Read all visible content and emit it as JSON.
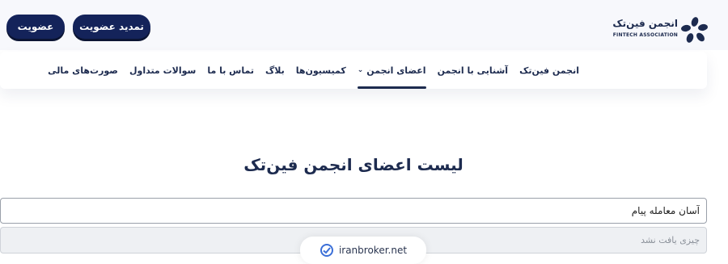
{
  "brand": {
    "title": "انجمن فین‌تک",
    "subtitle": "FINTECH ASSOCIATION",
    "logo_icon": "fintech-logo-mark",
    "color": "#1d2b4f"
  },
  "header": {
    "renew_label": "تمدید عضویت",
    "join_label": "عضویت",
    "button_color": "#14235a"
  },
  "nav": {
    "items": [
      {
        "label": "انجمن فین‌تک",
        "active": false
      },
      {
        "label": "آشنایی با انجمن",
        "active": false
      },
      {
        "label": "اعضای انجمن",
        "active": true,
        "has_dropdown": true
      },
      {
        "label": "کمیسیون‌ها",
        "active": false
      },
      {
        "label": "بلاگ",
        "active": false
      },
      {
        "label": "تماس با ما",
        "active": false
      },
      {
        "label": "سوالات متداول",
        "active": false
      },
      {
        "label": "صورت‌های مالی",
        "active": false
      }
    ]
  },
  "main": {
    "title": "لیست اعضای انجمن فین‌تک",
    "search_value": "آسان معامله پیام",
    "no_result": "چیزی یافت نشد"
  },
  "watermark": {
    "text": "iranbroker.net",
    "icon": "iranbroker-check-icon"
  }
}
